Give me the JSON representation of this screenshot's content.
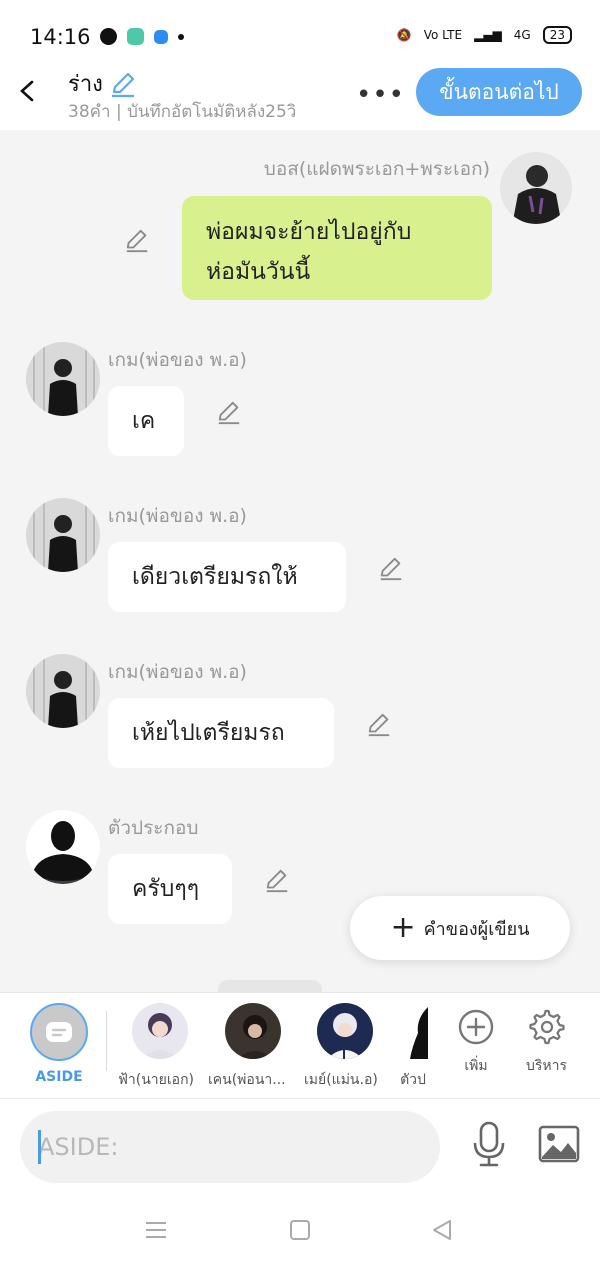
{
  "status_bar": {
    "time": "14:16",
    "right_text": "Vo LTE",
    "network": "4G",
    "battery": "23"
  },
  "header": {
    "title": "ร่าง",
    "subtitle": "38คำ | บันทึกอัตโนมัติหลัง25วิ",
    "next_label": "ขั้นตอนต่อไป",
    "accent": "#5aa9f2"
  },
  "messages": [
    {
      "sender": "บอส(แฝดพระเอก+พระเอก)",
      "text": "พ่อผมจะย้ายไปอยู่กับ\nห่อมันวันนี้",
      "side": "right"
    },
    {
      "sender": "เกม(พ่อของ พ.อ)",
      "text": "เค",
      "side": "left"
    },
    {
      "sender": "เกม(พ่อของ พ.อ)",
      "text": "เดียวเตรียมรถให้",
      "side": "left"
    },
    {
      "sender": "เกม(พ่อของ พ.อ)",
      "text": "เห้ยไปเตรียมรถ",
      "side": "left"
    },
    {
      "sender": "ตัวประกอบ",
      "text": "ครับๆๆ",
      "side": "left"
    }
  ],
  "writer_button": {
    "label": "คำของผู้เขียน"
  },
  "characters": [
    {
      "label": "ASIDE"
    },
    {
      "label": "ฟ้า(นายเอก)"
    },
    {
      "label": "เคน(พ่อนา..."
    },
    {
      "label": "เมย์(แม่น.อ)"
    },
    {
      "label": "ตัวป"
    }
  ],
  "actions": {
    "add_label": "เพิ่ม",
    "manage_label": "บริหาร"
  },
  "input": {
    "placeholder": "ASIDE:"
  }
}
